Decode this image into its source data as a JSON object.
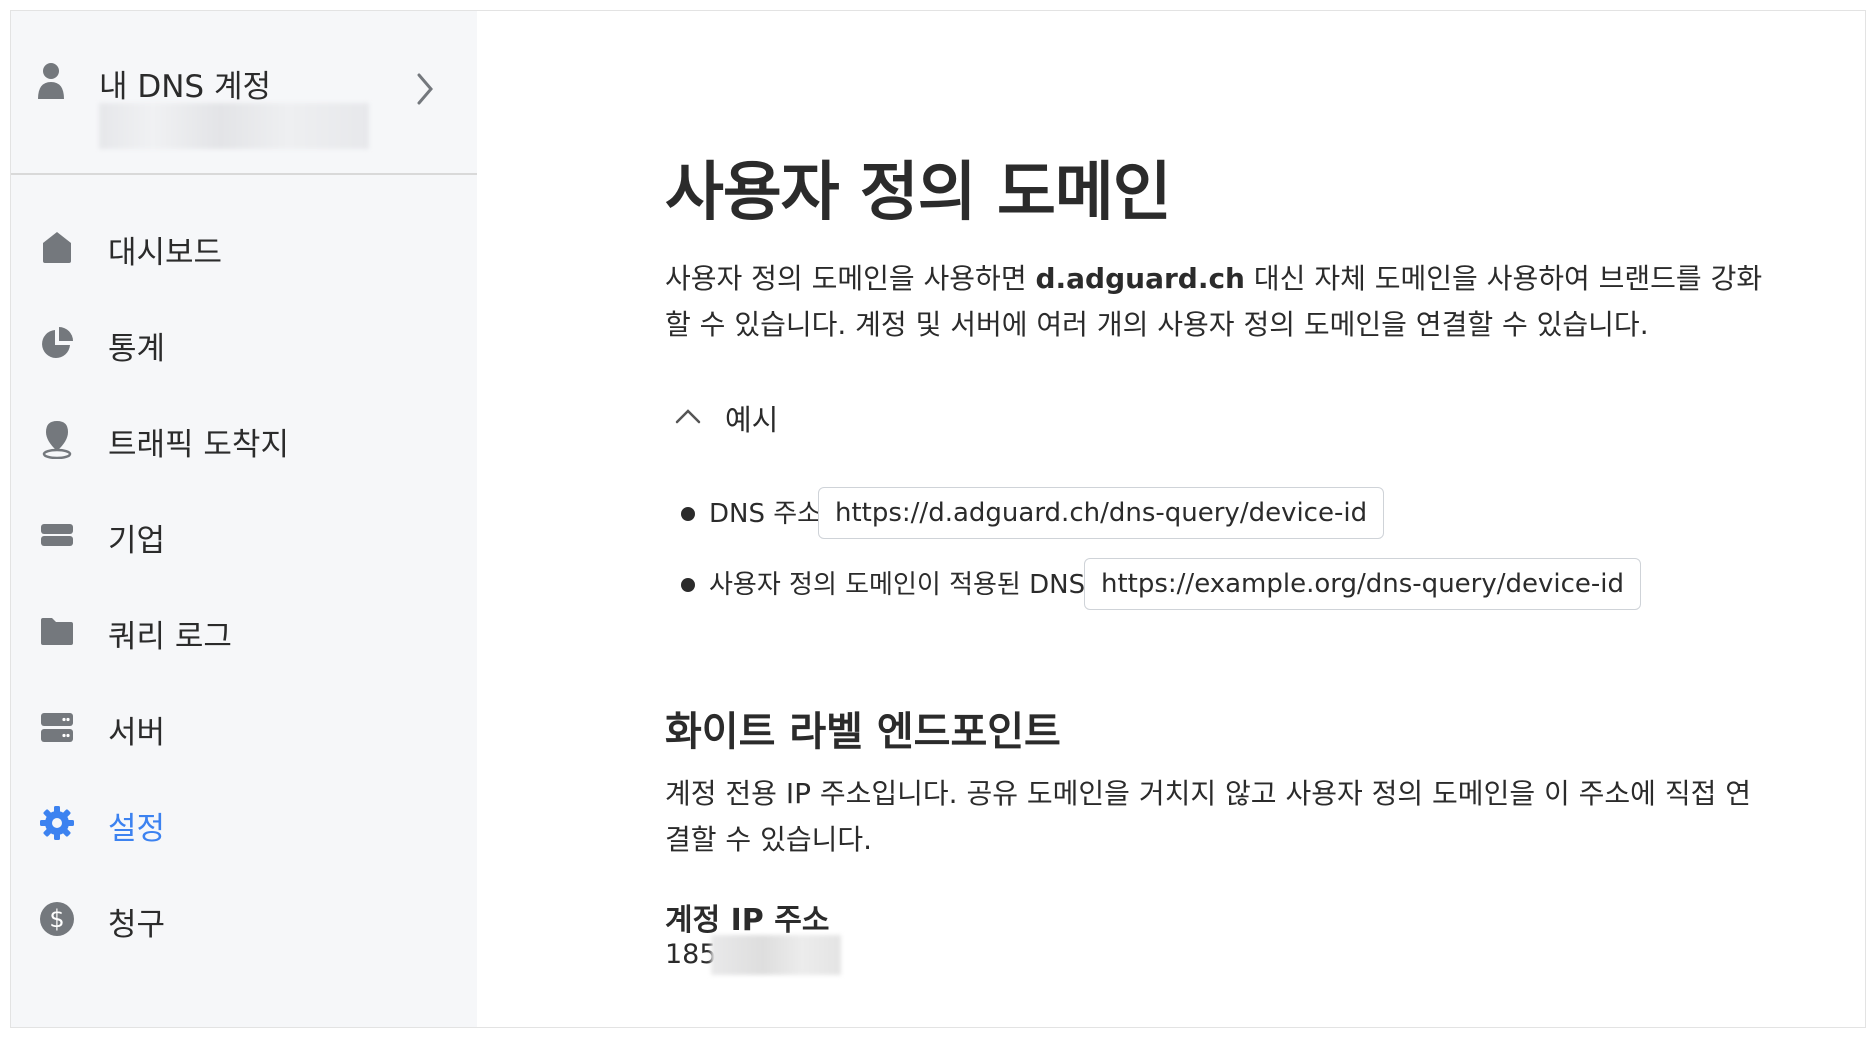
{
  "sidebar": {
    "account": {
      "title": "내 DNS 계정",
      "icon": "person-icon",
      "chevron_icon": "chevron-right-icon"
    },
    "items": [
      {
        "label": "대시보드",
        "icon": "home-icon",
        "active": false
      },
      {
        "label": "통계",
        "icon": "pie-chart-icon",
        "active": false
      },
      {
        "label": "트래픽 도착지",
        "icon": "location-pin-icon",
        "active": false
      },
      {
        "label": "기업",
        "icon": "card-icon",
        "active": false
      },
      {
        "label": "쿼리 로그",
        "icon": "folder-icon",
        "active": false
      },
      {
        "label": "서버",
        "icon": "server-icon",
        "active": false
      },
      {
        "label": "설정",
        "icon": "gear-icon",
        "active": true
      },
      {
        "label": "청구",
        "icon": "dollar-icon",
        "active": false
      }
    ]
  },
  "main": {
    "title": "사용자 정의 도메인",
    "intro_part1": "사용자 정의 도메인을 사용하면 ",
    "intro_bold": "d.adguard.ch",
    "intro_part2": " 대신 자체 도메인을 사용하여 브랜드를 강화할 수 있습니다. 계정 및 서버에 여러 개의 사용자 정의 도메인을 연결할 수 있습니다.",
    "example_toggle": "예시",
    "examples": [
      {
        "label": "DNS 주소:",
        "value": "https://d.adguard.ch/dns-query/device-id"
      },
      {
        "label": "사용자 정의 도메인이 적용된 DNS 주소:",
        "value": "https://example.org/dns-query/device-id"
      }
    ],
    "whitelabel_heading": "화이트 라벨 엔드포인트",
    "whitelabel_desc": "계정 전용 IP 주소입니다. 공유 도메인을 거치지 않고 사용자 정의 도메인을 이 주소에 직접 연결할 수 있습니다.",
    "ip_heading": "계정 IP 주소",
    "ip_value_visible": "185."
  },
  "colors": {
    "accent": "#3c82f0",
    "sidebar_bg": "#f6f7f9",
    "icon_gray": "#74787d",
    "text": "#2b2b2b"
  }
}
